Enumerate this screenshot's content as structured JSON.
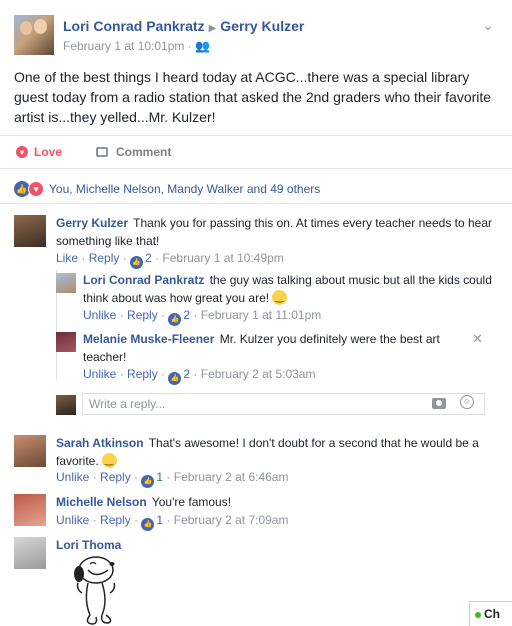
{
  "post": {
    "author": "Lori Conrad Pankratz",
    "recipient": "Gerry Kulzer",
    "timestamp": "February 1 at 10:01pm",
    "audience_icon": "friends-icon",
    "text": "One of the best things I heard today at ACGC...there was a special library guest today from a radio station that asked the 2nd graders who their favorite artist is...they yelled...Mr. Kulzer!"
  },
  "actions": {
    "love_label": "Love",
    "comment_label": "Comment"
  },
  "reactions": {
    "summary": "You, Michelle Nelson, Mandy Walker and 49 others"
  },
  "comments": [
    {
      "author": "Gerry Kulzer",
      "text": "Thank you for passing this on. At times every teacher needs to hear something like that!",
      "action1": "Like",
      "action2": "Reply",
      "likes": "2",
      "time": "February 1 at 10:49pm"
    },
    {
      "author": "Lori Conrad Pankratz",
      "text": "the guy was talking about music but all the kids could think about was how great you are!",
      "action1": "Unlike",
      "action2": "Reply",
      "likes": "2",
      "time": "February 1 at 11:01pm"
    },
    {
      "author": "Melanie Muske-Fleener",
      "text": "Mr. Kulzer you definitely were the best art teacher!",
      "action1": "Unlike",
      "action2": "Reply",
      "likes": "2",
      "time": "February 2 at 5:03am"
    },
    {
      "author": "Sarah Atkinson",
      "text": "That's awesome! I don't doubt for a second that he would be a favorite.",
      "action1": "Unlike",
      "action2": "Reply",
      "likes": "1",
      "time": "February 2 at 6:46am"
    },
    {
      "author": "Michelle Nelson",
      "text": "You're famous!",
      "action1": "Unlike",
      "action2": "Reply",
      "likes": "1",
      "time": "February 2 at 7:09am"
    },
    {
      "author": "Lori Thoma",
      "text": "",
      "sticker": "snoopy-sticker"
    }
  ],
  "reply_box": {
    "placeholder": "Write a reply..."
  },
  "chat": {
    "label": "Ch"
  },
  "colors": {
    "link": "#365899",
    "love": "#f25268",
    "like": "#4267b2",
    "meta": "#90949c",
    "online": "#42b72a"
  }
}
